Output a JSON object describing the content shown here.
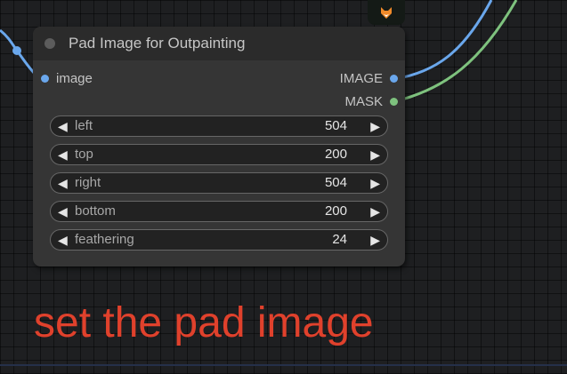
{
  "node": {
    "title": "Pad Image for Outpainting",
    "input_label": "image",
    "output_image_label": "IMAGE",
    "output_mask_label": "MASK",
    "widgets": [
      {
        "label": "left",
        "value": "504"
      },
      {
        "label": "top",
        "value": "200"
      },
      {
        "label": "right",
        "value": "504"
      },
      {
        "label": "bottom",
        "value": "200"
      },
      {
        "label": "feathering",
        "value": "24"
      }
    ],
    "decrement_glyph": "◀",
    "increment_glyph": "▶"
  },
  "annotation": {
    "text": "set the pad image"
  },
  "colors": {
    "image_link": "#6aa7ec",
    "mask_link": "#7ec27e",
    "annotation": "#e0412c"
  },
  "icons": {
    "top_node_icon": "fox-icon"
  }
}
